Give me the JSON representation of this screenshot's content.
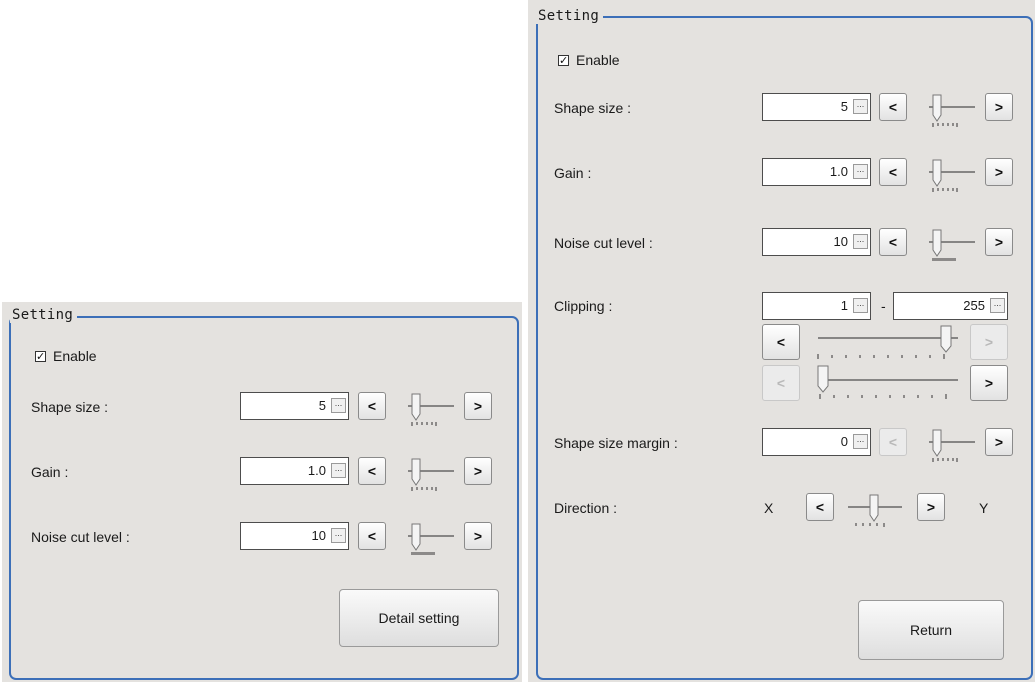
{
  "left_panel": {
    "group_title": "Setting",
    "enable_label": "Enable",
    "enable_checked": "✓",
    "shape_size": {
      "label": "Shape size :",
      "value": "5"
    },
    "gain": {
      "label": "Gain :",
      "value": "1.0"
    },
    "noise_cut": {
      "label": "Noise cut level :",
      "value": "10"
    },
    "detail_button": "Detail setting"
  },
  "right_panel": {
    "group_title": "Setting",
    "enable_label": "Enable",
    "enable_checked": "✓",
    "shape_size": {
      "label": "Shape size :",
      "value": "5"
    },
    "gain": {
      "label": "Gain :",
      "value": "1.0"
    },
    "noise_cut": {
      "label": "Noise cut level :",
      "value": "10"
    },
    "clipping": {
      "label": "Clipping :",
      "min": "1",
      "separator": "-",
      "max": "255"
    },
    "shape_margin": {
      "label": "Shape size margin :",
      "value": "0"
    },
    "direction": {
      "label": "Direction :",
      "x_label": "X",
      "y_label": "Y"
    },
    "return_button": "Return"
  },
  "common": {
    "dec": "<",
    "inc": ">",
    "browse": "..."
  },
  "icons": {
    "slider": "slider-thumb-icon",
    "check": "checkmark-icon"
  },
  "colors": {
    "panel_bg": "#e4e2df",
    "group_border": "#3c6fb8"
  }
}
